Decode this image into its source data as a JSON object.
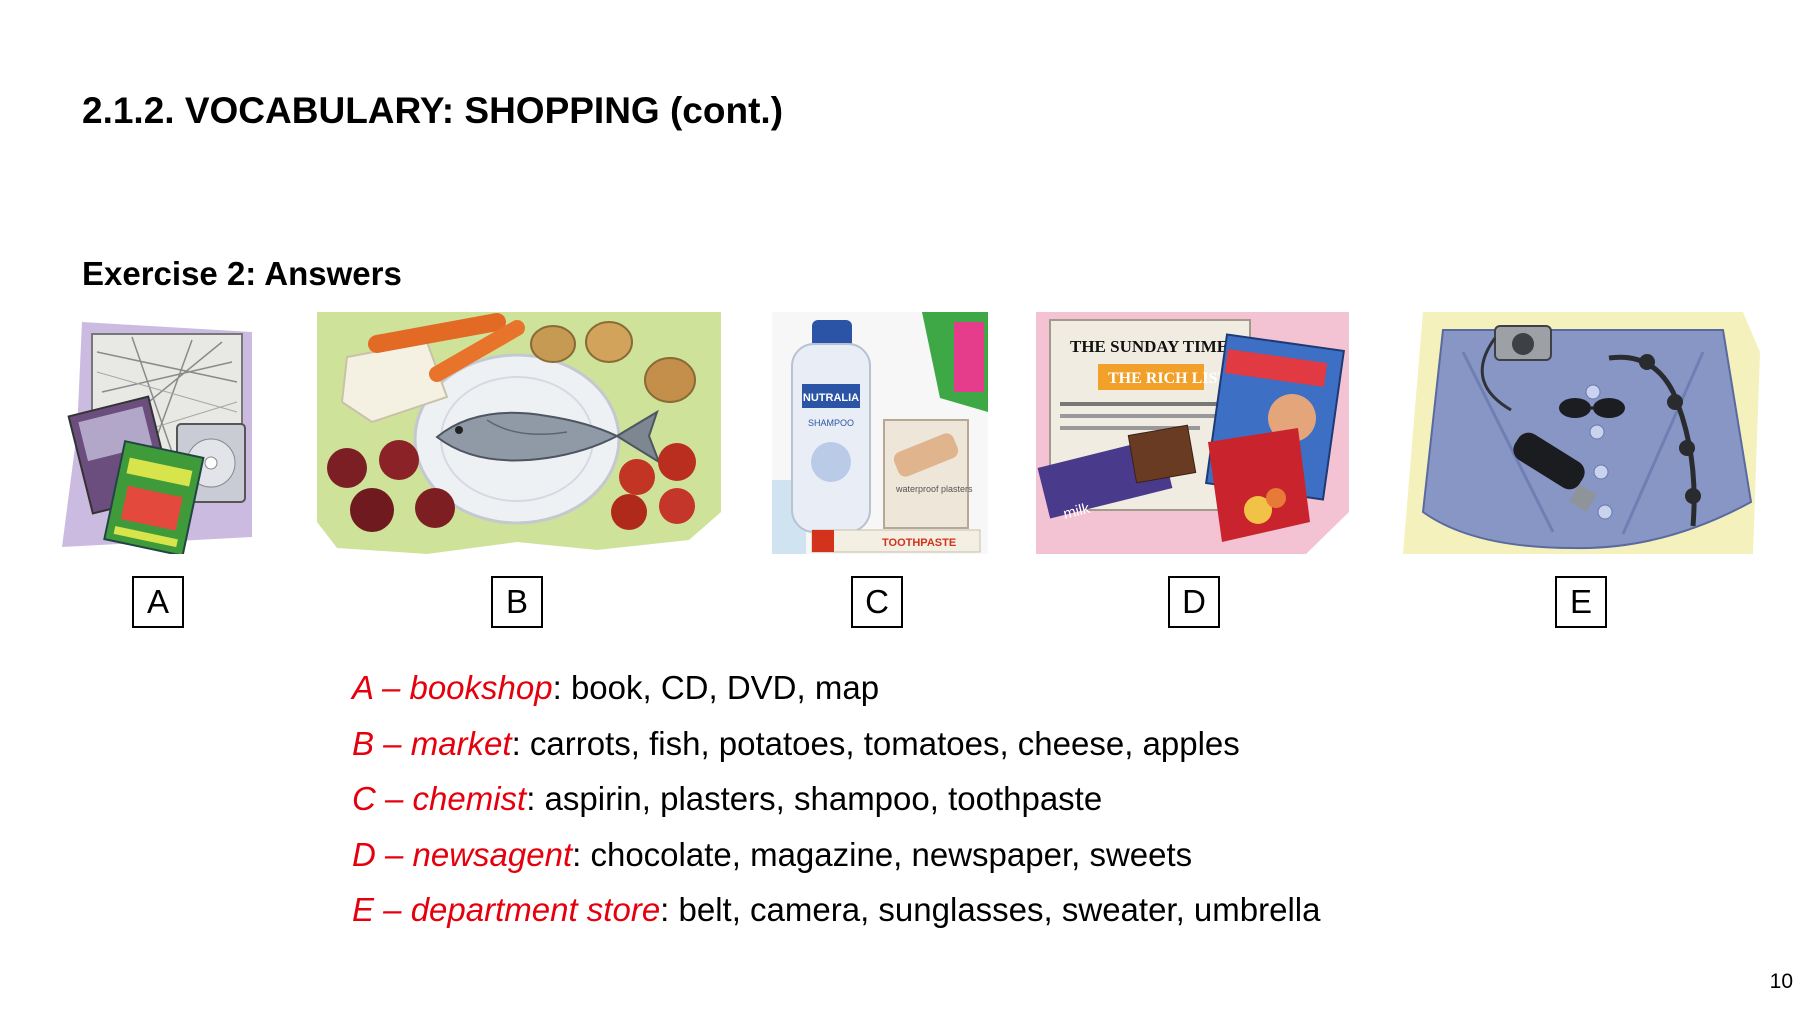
{
  "slide": {
    "title": "2.1.2. VOCABULARY: SHOPPING (cont.)",
    "exercise_heading": "Exercise 2: Answers",
    "page_number": "10"
  },
  "photos": [
    {
      "label": "A",
      "depicts": "book, CD, DVD, map"
    },
    {
      "label": "B",
      "depicts": "carrots, fish, potatoes, tomatoes, cheese, apples"
    },
    {
      "label": "C",
      "depicts": "shampoo, plasters, toothpaste"
    },
    {
      "label": "D",
      "depicts": "newspaper, magazine, chocolate, sweets"
    },
    {
      "label": "E",
      "depicts": "sweater, camera, sunglasses, belt, umbrella"
    }
  ],
  "photo_text": {
    "c_shampoo_brand": "NUTRALIA",
    "c_shampoo_type": "SHAMPOO",
    "c_plasters": "waterproof plasters",
    "c_toothpaste": "TOOTHPASTE",
    "d_newspaper": "THE SUNDAY TIMES",
    "d_headline": "THE RICH LIST",
    "d_chocolate": "milk"
  },
  "answers": [
    {
      "key": "A – bookshop",
      "items": ": book, CD, DVD, map"
    },
    {
      "key": "B – market",
      "items": ": carrots, fish, potatoes, tomatoes, cheese, apples"
    },
    {
      "key": "C – chemist",
      "items": ": aspirin, plasters, shampoo, toothpaste"
    },
    {
      "key": "D – newsagent",
      "items": ": chocolate, magazine, newspaper, sweets"
    },
    {
      "key": "E – department store",
      "items": ": belt, camera, sunglasses, sweater, umbrella"
    }
  ],
  "colors": {
    "answer_key": "#e6000d",
    "text": "#000000"
  }
}
